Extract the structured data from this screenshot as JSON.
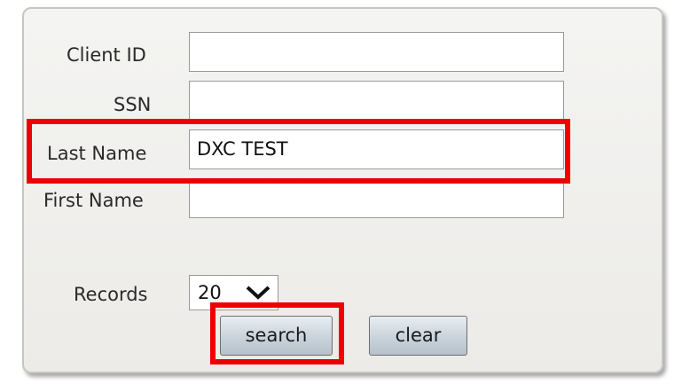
{
  "form": {
    "client_id": {
      "label": "Client ID",
      "value": ""
    },
    "ssn": {
      "label": "SSN",
      "value": ""
    },
    "last_name": {
      "label": "Last Name",
      "value": "DXC TEST"
    },
    "first_name": {
      "label": "First Name",
      "value": ""
    },
    "records": {
      "label": "Records",
      "selected": "20"
    }
  },
  "buttons": {
    "search_label": "search",
    "clear_label": "clear"
  },
  "icons": {
    "records_dropdown": "chevron-down-icon"
  },
  "colors": {
    "highlight": "#ee0000",
    "panel_background": "#efefec",
    "button_gradient_top": "#e8eef3",
    "button_gradient_bottom": "#b6c2cc"
  }
}
